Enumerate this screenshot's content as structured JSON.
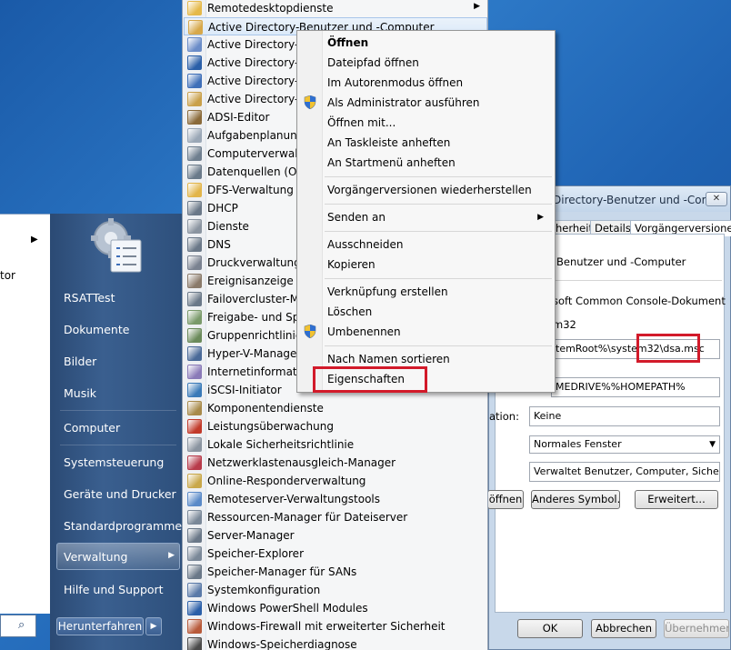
{
  "properties_dialog": {
    "title": "Directory-Benutzer und -Com...",
    "close_label": "✕",
    "tabs": [
      "herheit",
      "Details",
      "Vorgängerversionen"
    ],
    "name_value": "Benutzer und -Computer",
    "type_value": "soft Common Console-Dokument",
    "location_value": "m32",
    "target_value": "temRoot%\\system32\\dsa.msc",
    "start_in_value": "MEDRIVE%%HOMEPATH%",
    "shortcut_label": "ation:",
    "shortcut_value": "Keine",
    "run_value": "Normales Fenster",
    "comment_value": "Verwaltet Benutzer, Computer, Sicherheitsg",
    "buttons": {
      "open_location": "öffnen",
      "change_icon": "Anderes Symbol...",
      "advanced": "Erweitert...",
      "ok": "OK",
      "cancel": "Abbrechen",
      "apply": "Übernehmen"
    }
  },
  "start_menu": {
    "left_fragment": "tor",
    "right_items": [
      "RSATTest",
      "Dokumente",
      "Bilder",
      "Musik",
      "Computer",
      "Systemsteuerung",
      "Geräte und Drucker",
      "Standardprogramme",
      "Verwaltung",
      "Hilfe und Support"
    ],
    "shutdown_label": "Herunterfahren",
    "verwaltung_arrow": "▶"
  },
  "submenu": {
    "items": [
      {
        "label": "Remotedesktopdienste",
        "icon": "folder-icon",
        "color": "#e5b94a",
        "arrow": "▶"
      },
      {
        "label": "Active Directory-Benutzer und -Computer",
        "icon": "ad-users-icon",
        "color": "#d7a84a"
      },
      {
        "label": "Active Directory-D",
        "icon": "ad-domains-icon",
        "color": "#6a8cc8"
      },
      {
        "label": "Active Directory-M",
        "icon": "powershell-icon",
        "color": "#2a5fa8"
      },
      {
        "label": "Active Directory-St",
        "icon": "ad-sites-icon",
        "color": "#3f6fb8"
      },
      {
        "label": "Active Directory-Ve",
        "icon": "ad-admin-icon",
        "color": "#c9a04a"
      },
      {
        "label": "ADSI-Editor",
        "icon": "adsi-icon",
        "color": "#8a6a3a"
      },
      {
        "label": "Aufgabenplanung",
        "icon": "clock-icon",
        "color": "#9aa7b6"
      },
      {
        "label": "Computerverwaltu",
        "icon": "computer-mgmt-icon",
        "color": "#6f7f8f"
      },
      {
        "label": "Datenquellen (ODB",
        "icon": "odbc-icon",
        "color": "#6a7a8a"
      },
      {
        "label": "DFS-Verwaltung",
        "icon": "dfs-icon",
        "color": "#e2b54a"
      },
      {
        "label": "DHCP",
        "icon": "dhcp-icon",
        "color": "#6a7888"
      },
      {
        "label": "Dienste",
        "icon": "gear-icon",
        "color": "#8a94a0"
      },
      {
        "label": "DNS",
        "icon": "dns-icon",
        "color": "#6a7888"
      },
      {
        "label": "Druckverwaltung",
        "icon": "printer-icon",
        "color": "#7a8290"
      },
      {
        "label": "Ereignisanzeige",
        "icon": "event-viewer-icon",
        "color": "#8a7a6a"
      },
      {
        "label": "Failovercluster-Ma",
        "icon": "cluster-icon",
        "color": "#6a7888"
      },
      {
        "label": "Freigabe- und Spei",
        "icon": "share-icon",
        "color": "#7a9a6a"
      },
      {
        "label": "Gruppenrichtlinien",
        "icon": "gpo-icon",
        "color": "#6a8a5a"
      },
      {
        "label": "Hyper-V-Manager",
        "icon": "hyperv-icon",
        "color": "#4a6a98"
      },
      {
        "label": "Internetinformatio",
        "icon": "iis-icon",
        "color": "#8a7ab8"
      },
      {
        "label": "iSCSI-Initiator",
        "icon": "iscsi-icon",
        "color": "#3a7ab8"
      },
      {
        "label": "Komponentendienste",
        "icon": "component-icon",
        "color": "#a88a4a"
      },
      {
        "label": "Leistungsüberwachung",
        "icon": "perf-monitor-icon",
        "color": "#c23a2a"
      },
      {
        "label": "Lokale Sicherheitsrichtlinie",
        "icon": "security-policy-icon",
        "color": "#8a94a0"
      },
      {
        "label": "Netzwerklastenausgleich-Manager",
        "icon": "nlb-icon",
        "color": "#b83a4a"
      },
      {
        "label": "Online-Responderverwaltung",
        "icon": "responder-icon",
        "color": "#c9a84a"
      },
      {
        "label": "Remoteserver-Verwaltungstools",
        "icon": "rsat-icon",
        "color": "#5a8ac8"
      },
      {
        "label": "Ressourcen-Manager für Dateiserver",
        "icon": "fsrm-icon",
        "color": "#7a8898"
      },
      {
        "label": "Server-Manager",
        "icon": "server-manager-icon",
        "color": "#6a7888"
      },
      {
        "label": "Speicher-Explorer",
        "icon": "storage-explorer-icon",
        "color": "#7a8898"
      },
      {
        "label": "Speicher-Manager für SANs",
        "icon": "san-icon",
        "color": "#6a7888"
      },
      {
        "label": "Systemkonfiguration",
        "icon": "msconfig-icon",
        "color": "#5a7aa8"
      },
      {
        "label": "Windows PowerShell Modules",
        "icon": "powershell-icon",
        "color": "#2a5fa8"
      },
      {
        "label": "Windows-Firewall mit erweiterter Sicherheit",
        "icon": "firewall-icon",
        "color": "#b85a3a"
      },
      {
        "label": "Windows-Speicherdiagnose",
        "icon": "memory-diag-icon",
        "color": "#4a4a4a"
      }
    ]
  },
  "context_menu": {
    "items": [
      {
        "label": "Öffnen",
        "bold": true
      },
      {
        "label": "Dateipfad öffnen"
      },
      {
        "label": "Im Autorenmodus öffnen"
      },
      {
        "label": "Als Administrator ausführen",
        "shield": true
      },
      {
        "label": "Öffnen mit..."
      },
      {
        "label": "An Taskleiste anheften"
      },
      {
        "label": "An Startmenü anheften"
      },
      {
        "label": "Vorgängerversionen wiederherstellen"
      },
      {
        "label": "Senden an",
        "arrow": "▶"
      },
      {
        "label": "Ausschneiden"
      },
      {
        "label": "Kopieren"
      },
      {
        "label": "Verknüpfung erstellen"
      },
      {
        "label": "Löschen"
      },
      {
        "label": "Umbenennen",
        "shield": true
      },
      {
        "label": "Nach Namen sortieren"
      },
      {
        "label": "Eigenschaften"
      }
    ]
  },
  "colors": {
    "highlight_box": "#d21a2a"
  }
}
